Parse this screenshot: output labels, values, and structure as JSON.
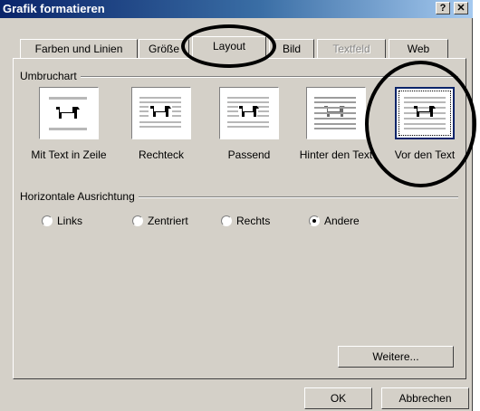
{
  "window": {
    "title": "Grafik formatieren",
    "help_glyph": "?",
    "close_glyph": "✕"
  },
  "tabs": [
    {
      "label": "Farben und Linien",
      "state": "normal"
    },
    {
      "label": "Größe",
      "state": "normal"
    },
    {
      "label": "Layout",
      "state": "active"
    },
    {
      "label": "Bild",
      "state": "normal"
    },
    {
      "label": "Textfeld",
      "state": "disabled"
    },
    {
      "label": "Web",
      "state": "normal"
    }
  ],
  "wrapping": {
    "group_label": "Umbruchart",
    "options": [
      {
        "label": "Mit Text in Zeile",
        "icon": "inline-dog-icon",
        "selected": false
      },
      {
        "label": "Rechteck",
        "icon": "square-wrap-dog-icon",
        "selected": false
      },
      {
        "label": "Passend",
        "icon": "tight-wrap-dog-icon",
        "selected": false
      },
      {
        "label": "Hinter den Text",
        "icon": "behind-text-dog-icon",
        "selected": false
      },
      {
        "label": "Vor den Text",
        "icon": "in-front-dog-icon",
        "selected": true
      }
    ]
  },
  "alignment": {
    "group_label": "Horizontale Ausrichtung",
    "options": [
      {
        "label": "Links",
        "checked": false
      },
      {
        "label": "Zentriert",
        "checked": false
      },
      {
        "label": "Rechts",
        "checked": false
      },
      {
        "label": "Andere",
        "checked": true
      }
    ]
  },
  "buttons": {
    "more": "Weitere...",
    "ok": "OK",
    "cancel": "Abbrechen"
  },
  "colors": {
    "title_bar": "#0a246a",
    "dialog_face": "#d4d0c8",
    "annotation_circle": "#000000"
  }
}
